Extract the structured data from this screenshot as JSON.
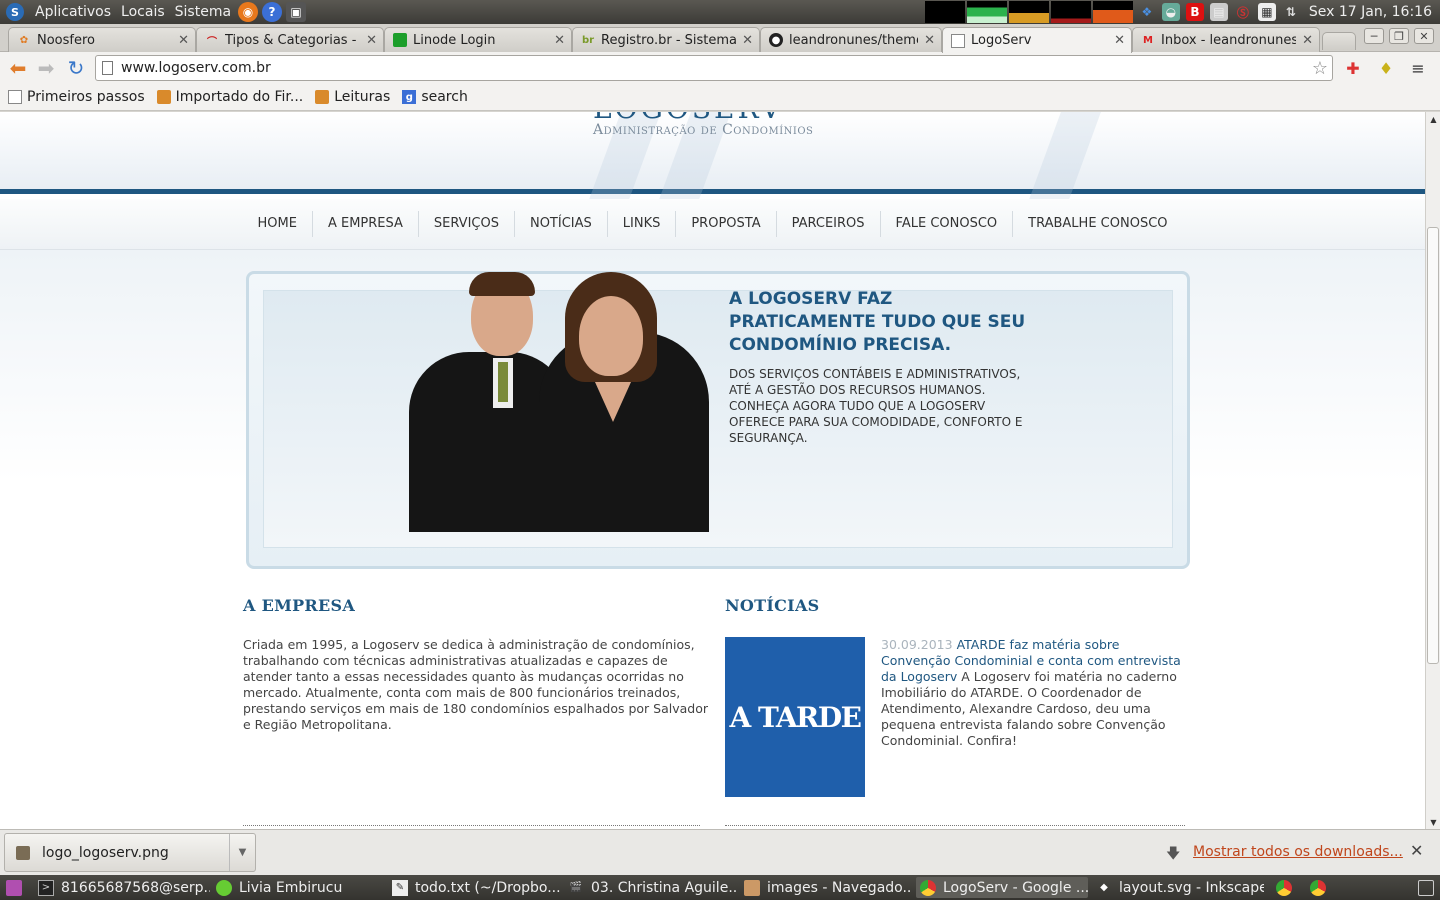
{
  "top_panel": {
    "menus": [
      "Aplicativos",
      "Locais",
      "Sistema"
    ],
    "clock": "Sex 17 Jan, 16:16"
  },
  "tabs": [
    {
      "title": "Noosfero",
      "icon": "noosfero-icon"
    },
    {
      "title": "Tipos & Categorias - R",
      "icon": "redmine-icon"
    },
    {
      "title": "Linode Login",
      "icon": "linode-icon"
    },
    {
      "title": "Registro.br - Sistema -",
      "icon": "registro-icon"
    },
    {
      "title": "leandronunes/theme_",
      "icon": "github-icon"
    },
    {
      "title": "LogoServ",
      "icon": "page-icon"
    },
    {
      "title": "Inbox - leandronunes(",
      "icon": "gmail-icon"
    }
  ],
  "toolbar": {
    "url": "www.logoserv.com.br"
  },
  "bookmarks": [
    {
      "label": "Primeiros passos",
      "icon": "doc"
    },
    {
      "label": "Importado do Fir...",
      "icon": "folder"
    },
    {
      "label": "Leituras",
      "icon": "folder"
    },
    {
      "label": "search",
      "icon": "google"
    }
  ],
  "site": {
    "logo_text": "LOGOSERV",
    "logo_sub": "Administração de Condomínios",
    "nav": [
      "HOME",
      "A EMPRESA",
      "SERVIÇOS",
      "NOTÍCIAS",
      "LINKS",
      "PROPOSTA",
      "PARCEIROS",
      "FALE CONOSCO",
      "TRABALHE CONOSCO"
    ],
    "banner": {
      "title": "A LOGOSERV FAZ PRATICAMENTE TUDO QUE SEU CONDOMÍNIO PRECISA.",
      "text": "DOS SERVIÇOS CONTÁBEIS E ADMINISTRATIVOS, ATÉ A GESTÃO DOS RECURSOS HUMANOS. CONHEÇA AGORA TUDO QUE A LOGOSERV OFERECE PARA SUA COMODIDADE, CONFORTO E SEGURANÇA."
    },
    "about": {
      "title": "A EMPRESA",
      "text": "Criada em 1995, a Logoserv se dedica à administração de condomínios, trabalhando com técnicas administrativas atualizadas e capazes de atender tanto a essas necessidades quanto às mudanças ocorridas no mercado. Atualmente, conta com mais de 800 funcionários treinados, prestando serviços em mais de 180 condomínios espalhados por Salvador e Região Metropolitana."
    },
    "news": {
      "title": "NOTÍCIAS",
      "image_text": "A TARDE",
      "date": "30.09.2013",
      "link": "ATARDE faz matéria sobre Convenção Condominial e conta com entrevista da Logoserv",
      "text": " A Logoserv foi matéria no caderno Imobiliário do ATARDE. O Coordenador de Atendimento, Alexandre Cardoso, deu uma pequena entrevista falando sobre Convenção Condominial. Confira!"
    }
  },
  "download_shelf": {
    "file": "logo_logoserv.png",
    "show_all": "Mostrar todos os downloads..."
  },
  "taskbar": [
    {
      "label": "81665687568@serp...",
      "icon": "terminal-icon"
    },
    {
      "label": "Livia Embirucu",
      "icon": "chat-icon"
    },
    {
      "label": "todo.txt (~/Dropbo...",
      "icon": "text-editor-icon"
    },
    {
      "label": "03. Christina Aguile...",
      "icon": "media-player-icon"
    },
    {
      "label": "images - Navegado...",
      "icon": "file-browser-icon"
    },
    {
      "label": "LogoServ - Google ...",
      "icon": "chrome-icon"
    },
    {
      "label": "layout.svg - Inkscape",
      "icon": "inkscape-icon"
    }
  ]
}
